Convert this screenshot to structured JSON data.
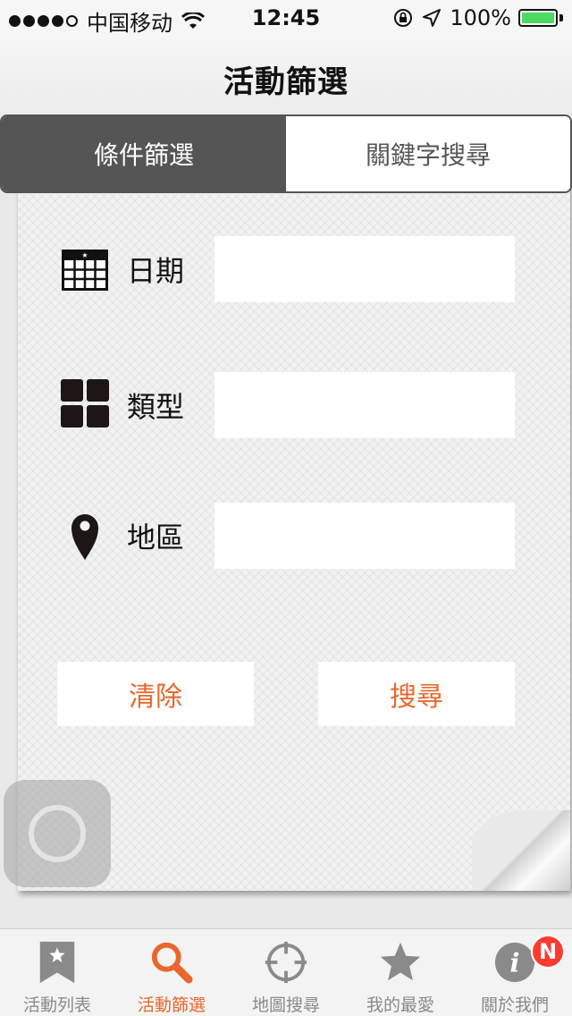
{
  "status_bar": {
    "carrier": "中国移动",
    "time": "12:45",
    "battery": "100%"
  },
  "nav": {
    "title": "活動篩選"
  },
  "segments": [
    {
      "label": "條件篩選",
      "active": true
    },
    {
      "label": "關鍵字搜尋",
      "active": false
    }
  ],
  "form": {
    "fields": [
      {
        "label": "日期",
        "icon": "calendar-icon",
        "value": ""
      },
      {
        "label": "類型",
        "icon": "grid-icon",
        "value": ""
      },
      {
        "label": "地區",
        "icon": "map-pin-icon",
        "value": ""
      }
    ],
    "clear_label": "清除",
    "search_label": "搜尋"
  },
  "tabs": [
    {
      "label": "活動列表",
      "icon": "bookmark-star-icon",
      "active": false
    },
    {
      "label": "活動篩選",
      "icon": "search-icon",
      "active": true
    },
    {
      "label": "地圖搜尋",
      "icon": "crosshair-icon",
      "active": false
    },
    {
      "label": "我的最愛",
      "icon": "star-icon",
      "active": false
    },
    {
      "label": "關於我們",
      "icon": "info-icon",
      "active": false,
      "badge": "N"
    }
  ],
  "colors": {
    "accent": "#e8672c",
    "segment_active": "#555555",
    "tab_inactive": "#8a8a8a",
    "badge": "#ff3b30"
  }
}
